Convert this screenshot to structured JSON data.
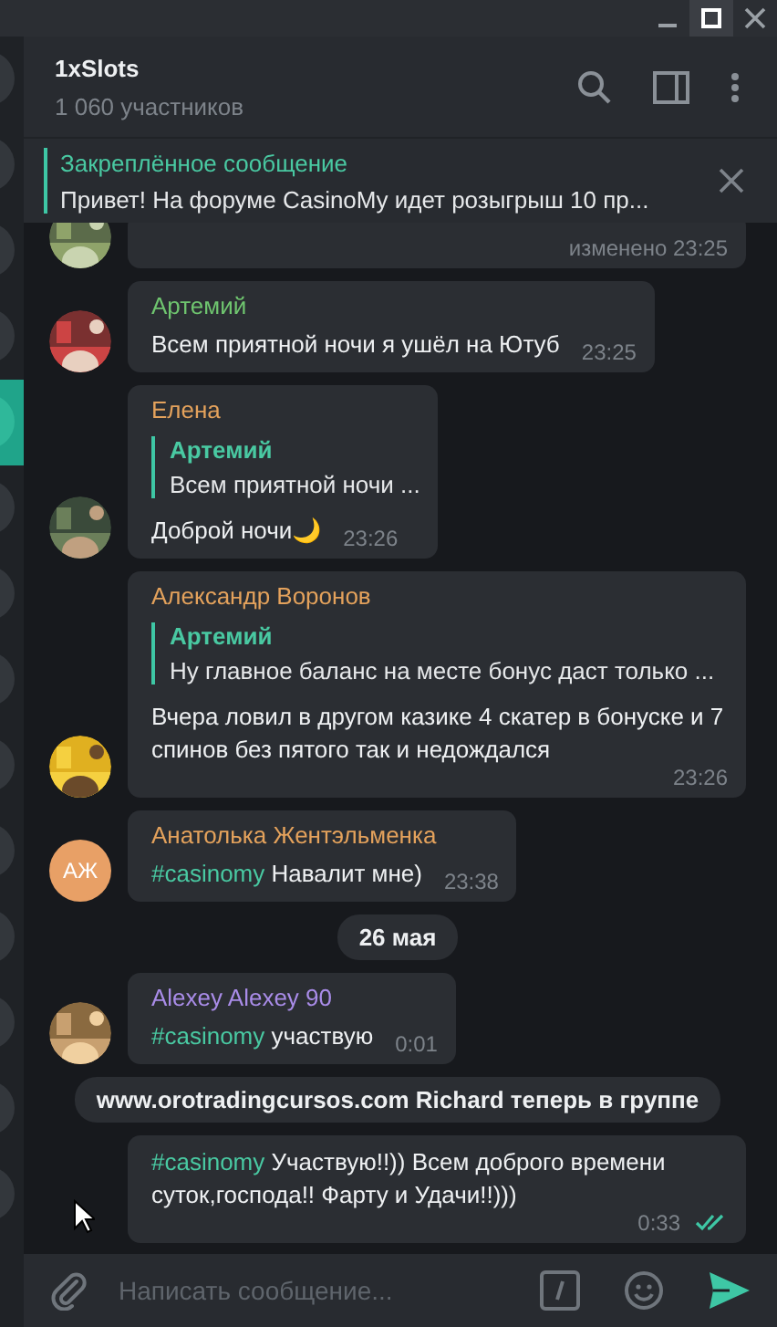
{
  "chat_list": [
    {
      "selected": false
    },
    {
      "selected": false
    },
    {
      "selected": false
    },
    {
      "selected": false
    },
    {
      "selected": true
    },
    {
      "selected": false
    },
    {
      "selected": false
    },
    {
      "selected": false
    },
    {
      "selected": false
    },
    {
      "selected": false
    },
    {
      "selected": false
    },
    {
      "selected": false
    },
    {
      "selected": false
    },
    {
      "selected": false
    }
  ],
  "header": {
    "title": "1xSlots",
    "subtitle": "1 060 участников"
  },
  "pinned": {
    "label": "Закреплённое сообщение",
    "text": "Привет! На форуме CasinoMy идет розыгрыш 10 пр..."
  },
  "messages": [
    {
      "kind": "message",
      "time": "изменено 23:25"
    },
    {
      "kind": "message",
      "author": "Артемий",
      "color": "#6fc56f",
      "text": "Всем приятной ночи я ушёл на Ютуб",
      "time": "23:25"
    },
    {
      "kind": "message",
      "author": "Елена",
      "color": "#e4a25c",
      "reply": {
        "author": "Артемий",
        "text": "Всем приятной ночи ..."
      },
      "text": "Доброй ночи🌙",
      "time": "23:26"
    },
    {
      "kind": "message",
      "author": "Александр Воронов",
      "color": "#e4a25c",
      "reply": {
        "author": "Артемий",
        "text": "Ну главное баланс на месте бонус даст только ..."
      },
      "text": "Вчера ловил в другом казике 4 скатер в бонуске и 7 спинов без пятого так и недождался",
      "time": "23:26"
    },
    {
      "kind": "message",
      "author": "Анатолька Жентэльменка",
      "color": "#e4a25c",
      "avatar": {
        "kind": "initials",
        "initials": "АЖ",
        "color": "#e8a066"
      },
      "hashtag": "#casinomy",
      "text": "Навалит мне)",
      "time": "23:38"
    },
    {
      "kind": "date",
      "text": "26 мая"
    },
    {
      "kind": "message",
      "author": "Alexey Alexey 90",
      "color": "#a98ce8",
      "hashtag": "#casinomy",
      "text": "участвую",
      "time": "0:01"
    },
    {
      "kind": "service",
      "text": "www.orotradingcursos.com Richard теперь в группе"
    },
    {
      "kind": "own",
      "hashtag": "#casinomy",
      "text": "Участвую!!)) Всем доброго времени суток,господа!! Фарту и Удачи!!)))",
      "time": "0:33",
      "read": true
    }
  ],
  "composer": {
    "placeholder": "Написать сообщение..."
  }
}
